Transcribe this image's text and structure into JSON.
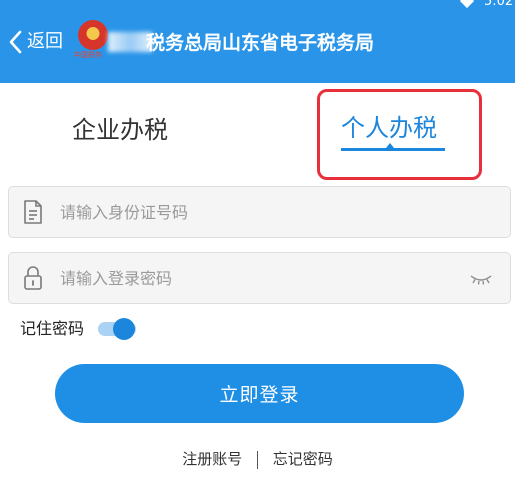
{
  "status_bar": {
    "time_fragment": "5:02"
  },
  "header": {
    "back_label": "返回",
    "title": "税务总局山东省电子税务局",
    "emblem_caption": "中国税务",
    "background_color": "#2a95e8"
  },
  "tabs": [
    {
      "label": "企业办税",
      "selected": false
    },
    {
      "label": "个人办税",
      "selected": true
    }
  ],
  "form": {
    "id_field": {
      "placeholder": "请输入身份证号码",
      "value": "",
      "icon": "id-card-icon"
    },
    "password_field": {
      "placeholder": "请输入登录密码",
      "value": "",
      "icon": "lock-icon",
      "toggle_icon": "eye-closed-icon"
    },
    "remember_label": "记住密码",
    "remember_enabled": true,
    "login_label": "立即登录"
  },
  "footer": {
    "register_label": "注册账号",
    "forgot_label": "忘记密码"
  },
  "colors": {
    "accent": "#1c86dc",
    "highlight": "#e8303c"
  }
}
